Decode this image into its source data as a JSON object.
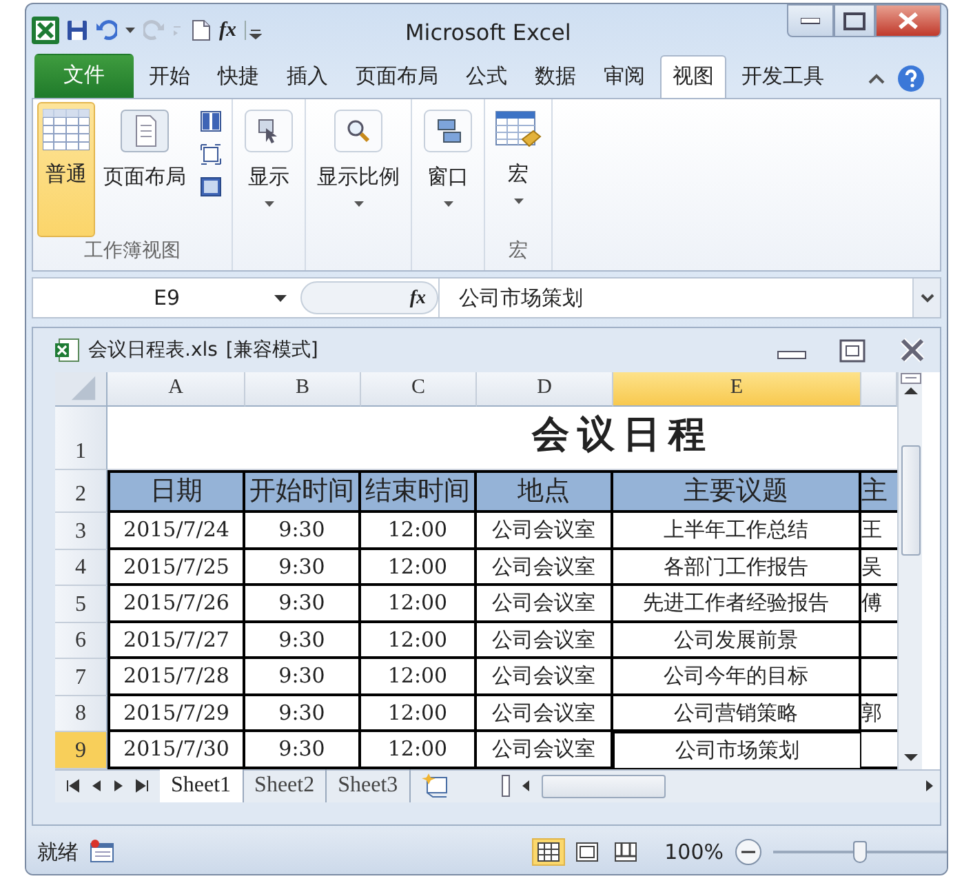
{
  "window": {
    "title": "Microsoft Excel",
    "qat_function": "fx"
  },
  "ribbon_tabs": [
    {
      "label": "文件",
      "kind": "file",
      "selected": false
    },
    {
      "label": "开始",
      "kind": "tab",
      "selected": false
    },
    {
      "label": "快捷",
      "kind": "tab",
      "selected": false
    },
    {
      "label": "插入",
      "kind": "tab",
      "selected": false
    },
    {
      "label": "页面布局",
      "kind": "tab",
      "selected": false
    },
    {
      "label": "公式",
      "kind": "tab",
      "selected": false
    },
    {
      "label": "数据",
      "kind": "tab",
      "selected": false
    },
    {
      "label": "审阅",
      "kind": "tab",
      "selected": false
    },
    {
      "label": "视图",
      "kind": "tab",
      "selected": true
    },
    {
      "label": "开发工具",
      "kind": "tab",
      "selected": false
    }
  ],
  "ribbon_groups": [
    {
      "kind": "views",
      "label": "工作簿视图",
      "buttons": [
        {
          "label": "普通",
          "selected": true
        },
        {
          "label": "页面布局",
          "selected": false
        }
      ]
    },
    {
      "kind": "single",
      "buttons": [
        {
          "label": "显示",
          "selected": false
        }
      ]
    },
    {
      "kind": "single",
      "buttons": [
        {
          "label": "显示比例",
          "selected": false
        }
      ]
    },
    {
      "kind": "single",
      "buttons": [
        {
          "label": "窗口",
          "selected": false
        }
      ]
    },
    {
      "kind": "macro",
      "label": "宏",
      "buttons": [
        {
          "label": "宏",
          "selected": false
        }
      ]
    }
  ],
  "formula_bar": {
    "name_box": "E9",
    "fx": "fx",
    "content": "公司市场策划"
  },
  "workbook": {
    "title": "会议日程表.xls",
    "mode": "[兼容模式]",
    "columns": [
      {
        "label": "A",
        "selected": false
      },
      {
        "label": "B",
        "selected": false
      },
      {
        "label": "C",
        "selected": false
      },
      {
        "label": "D",
        "selected": false
      },
      {
        "label": "E",
        "selected": true
      }
    ],
    "rows": [
      {
        "number": "1",
        "kind": "title",
        "selected": false,
        "title": "会议日程"
      },
      {
        "number": "2",
        "kind": "header",
        "selected": false,
        "cells": [
          {
            "text": "日期"
          },
          {
            "text": "开始时间"
          },
          {
            "text": "结束时间"
          },
          {
            "text": "地点"
          },
          {
            "text": "主要议题"
          },
          {
            "text": "主"
          }
        ]
      },
      {
        "number": "3",
        "kind": "data",
        "selected": false,
        "cells": [
          {
            "text": "2015/7/24"
          },
          {
            "text": "9:30"
          },
          {
            "text": "12:00"
          },
          {
            "text": "公司会议室"
          },
          {
            "text": "上半年工作总结"
          },
          {
            "text": "王"
          }
        ]
      },
      {
        "number": "4",
        "kind": "data",
        "selected": false,
        "cells": [
          {
            "text": "2015/7/25"
          },
          {
            "text": "9:30"
          },
          {
            "text": "12:00"
          },
          {
            "text": "公司会议室"
          },
          {
            "text": "各部门工作报告"
          },
          {
            "text": "吴"
          }
        ]
      },
      {
        "number": "5",
        "kind": "data",
        "selected": false,
        "cells": [
          {
            "text": "2015/7/26"
          },
          {
            "text": "9:30"
          },
          {
            "text": "12:00"
          },
          {
            "text": "公司会议室"
          },
          {
            "text": "先进工作者经验报告"
          },
          {
            "text": "傅"
          }
        ]
      },
      {
        "number": "6",
        "kind": "data",
        "selected": false,
        "cells": [
          {
            "text": "2015/7/27"
          },
          {
            "text": "9:30"
          },
          {
            "text": "12:00"
          },
          {
            "text": "公司会议室"
          },
          {
            "text": "公司发展前景"
          },
          {}
        ]
      },
      {
        "number": "7",
        "kind": "data",
        "selected": false,
        "cells": [
          {
            "text": "2015/7/28"
          },
          {
            "text": "9:30"
          },
          {
            "text": "12:00"
          },
          {
            "text": "公司会议室"
          },
          {
            "text": "公司今年的目标"
          },
          {}
        ]
      },
      {
        "number": "8",
        "kind": "data",
        "selected": false,
        "cells": [
          {
            "text": "2015/7/29"
          },
          {
            "text": "9:30"
          },
          {
            "text": "12:00"
          },
          {
            "text": "公司会议室"
          },
          {
            "text": "公司营销策略"
          },
          {
            "text": "郭"
          }
        ]
      },
      {
        "number": "9",
        "kind": "data",
        "selected": true,
        "cells": [
          {
            "text": "2015/7/30"
          },
          {
            "text": "9:30"
          },
          {
            "text": "12:00"
          },
          {
            "text": "公司会议室"
          },
          {
            "text": "公司市场策划",
            "selected": true
          },
          {}
        ]
      }
    ],
    "sheets": [
      {
        "label": "Sheet1",
        "selected": true
      },
      {
        "label": "Sheet2",
        "selected": false
      },
      {
        "label": "Sheet3",
        "selected": false
      }
    ]
  },
  "status_bar": {
    "text": "就绪",
    "views": [
      {
        "selected": true
      },
      {
        "selected": false
      },
      {
        "selected": false
      }
    ],
    "zoom": "100%",
    "zoom_slider": {
      "level": 0.5
    }
  }
}
